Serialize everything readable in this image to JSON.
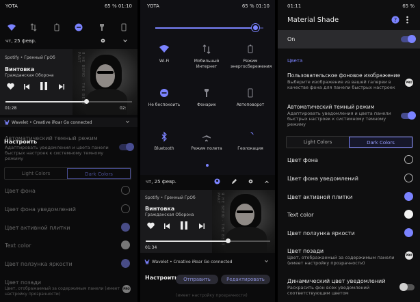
{
  "colors": {
    "accent": "#7b83ff",
    "bg": "#0b0b0c",
    "card": "#1a1a1c"
  },
  "p1": {
    "status": {
      "carrier": "YOTA",
      "right": "65 %  01:10"
    },
    "date": "чт, 25 февр.",
    "media": {
      "source": "Spotify • Гренный ГрОб",
      "title": "Винтовка",
      "artist": "Гражданская Оборона",
      "elapsed": "01:28",
      "total": "02:",
      "progress": 0.64
    },
    "wavelet": "Wavelet • Creative iRoar Go connected",
    "configure": "Настроить",
    "auto_dark_title": "Автоматический темный режим",
    "auto_dark_desc": "Адаптировать уведомления и цвета панели быстрых настроек к системному темному режиму",
    "seg": [
      "Light Colors",
      "Dark Colors"
    ],
    "rows": [
      "Цвет фона",
      "Цвет фона уведомлений",
      "Цвет активной плитки",
      "Text color",
      "Цвет ползунка яркости",
      "Цвет позади"
    ],
    "bg_behind_desc": "Цвет, отображаемый за содержимым панели (имеет настройку прозрачности)",
    "pro": "PRO"
  },
  "p2": {
    "status": {
      "carrier": "YOTA",
      "right": "65 %  01:10"
    },
    "brightness": 0.93,
    "tiles": [
      {
        "icon": "wifi-icon",
        "label": "Wi-Fi",
        "active": true
      },
      {
        "icon": "mobile-data-icon",
        "label": "Мобильный Интернет",
        "active": false
      },
      {
        "icon": "battery-saver-icon",
        "label": "Режим энергосбережения",
        "active": false
      },
      {
        "icon": "dnd-icon",
        "label": "Не беспокоить",
        "active": true
      },
      {
        "icon": "flashlight-icon",
        "label": "Фонарик",
        "active": false
      },
      {
        "icon": "autorotate-icon",
        "label": "Автоповорот",
        "active": false
      },
      {
        "icon": "bluetooth-icon",
        "label": "Bluetooth",
        "active": true
      },
      {
        "icon": "airplane-icon",
        "label": "Режим полета",
        "active": false
      },
      {
        "icon": "location-icon",
        "label": "Геолокация",
        "active": true
      }
    ],
    "date": "чт, 25 февр.",
    "media": {
      "source": "Spotify • Гренный ГрОб",
      "title": "Винтовка",
      "artist": "Гражданская Оборона",
      "elapsed": "01:34",
      "progress": 0.66
    },
    "wavelet": "Wavelet • Creative iRoar Go connected",
    "configure": "Настроить",
    "send": "Отправить",
    "edit": "Редактировать",
    "bottom_text": "(имеет настройку прозрачности)"
  },
  "p3": {
    "status": {
      "time": "01:11",
      "right": "65 %"
    },
    "title": "Material Shade",
    "on_label": "On",
    "section": "Цвета",
    "bgimg_title": "Пользовательское фоновое изображение",
    "bgimg_desc": "Выберите изображение из вашей галереи в качестве фона для панели быстрых настроек",
    "auto_dark_title": "Автоматический темный режим",
    "auto_dark_desc": "Адаптировать уведомления и цвета панели быстрых настроек к системному темному режиму",
    "seg": [
      "Light Colors",
      "Dark Colors"
    ],
    "rows": [
      "Цвет фона",
      "Цвет фона уведомлений",
      "Цвет активной плитки",
      "Text color",
      "Цвет ползунка яркости"
    ],
    "behind_title": "Цвет позади",
    "behind_desc": "Цвет, отображаемый за содержимым панели (имеет настройку прозрачности)",
    "dyn_title": "Динамический цвет уведомлений",
    "dyn_desc": "Раскрасить фон всех уведомлений соответствующим цветом",
    "pro": "PRO"
  }
}
